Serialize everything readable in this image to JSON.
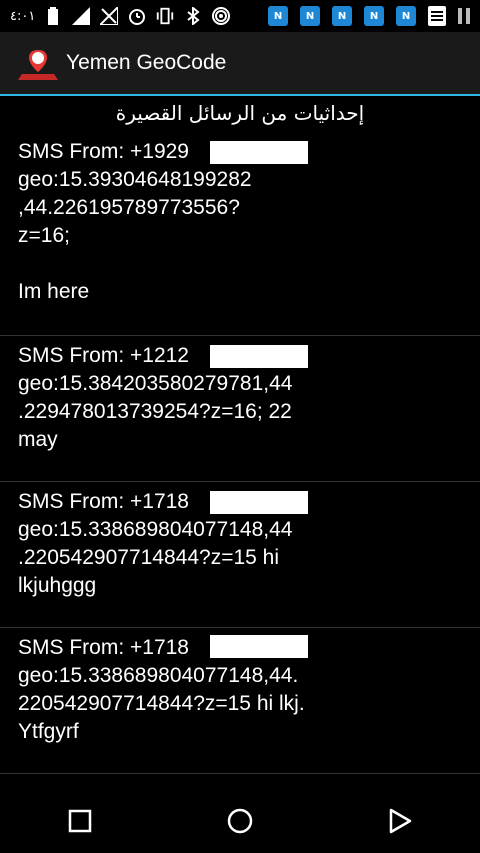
{
  "status_bar": {
    "time": "٤:٠١",
    "notification_badge": "N"
  },
  "app_bar": {
    "title": "Yemen GeoCode"
  },
  "header": {
    "title": "إحداثيات من الرسائل القصيرة"
  },
  "messages": [
    {
      "text": "SMS From: +1929\ngeo:15.39304648199282\n,44.226195789773556?\nz=16;\n\nIm here"
    },
    {
      "text": "SMS From: +1212\ngeo:15.384203580279781,44\n.229478013739254?z=16; 22\nmay"
    },
    {
      "text": "SMS From: +1718\ngeo:15.338689804077148,44\n.220542907714844?z=15 hi\nlkjuhggg"
    },
    {
      "text": "SMS From: +1718\ngeo:15.338689804077148,44.\n220542907714844?z=15 hi lkj.\nYtfgyrf"
    }
  ],
  "colors": {
    "accent": "#33b5e5",
    "app_bar_bg": "#1a1a1a",
    "notification_blue": "#1e88d6"
  }
}
